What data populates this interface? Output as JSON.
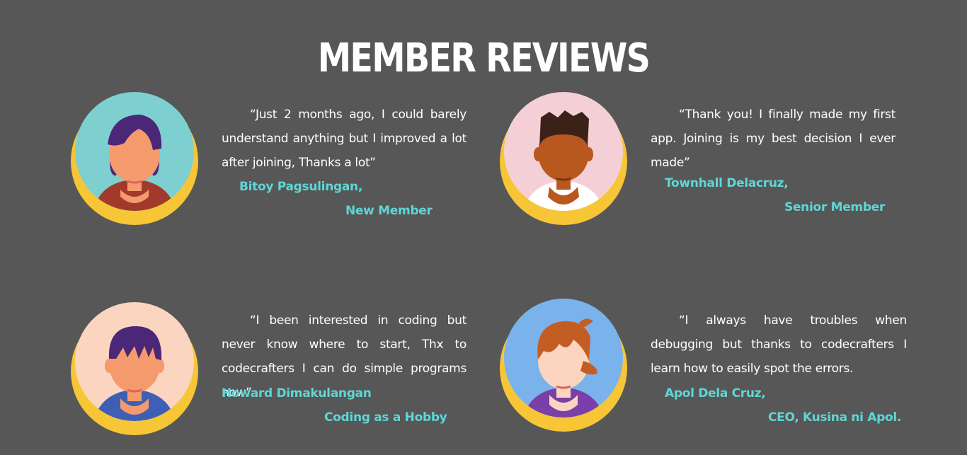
{
  "header": {
    "title": "MEMBER REVIEWS"
  },
  "colors": {
    "background": "#575757",
    "accent": "#5fd6d6",
    "ring": "#f7c636"
  },
  "reviews": [
    {
      "quote": "“Just 2 months ago, I could barely understand anything but I improved a lot after joining, Thanks a lot”",
      "name": "Bitoy Pagsulingan,",
      "role": "New Member",
      "avatar_icon": "female-avatar-icon"
    },
    {
      "quote": "“Thank you! I finally made my first app. Joining is my best decision I ever made”",
      "name": "Townhall Delacruz,",
      "role": "Senior Member",
      "avatar_icon": "male-avatar-icon"
    },
    {
      "quote": "“I been interested in coding but never know where to start, Thx to codecrafters I can do simple programs now”",
      "name": "Howard Dimakulangan",
      "role": "Coding as a Hobby",
      "avatar_icon": "male-avatar-icon"
    },
    {
      "quote": "“I always have troubles when debugging but thanks to codecrafters I learn how to easily spot the errors.",
      "name": "Apol Dela Cruz,",
      "role": "CEO, Kusina ni Apol.",
      "avatar_icon": "female-avatar-icon"
    }
  ]
}
